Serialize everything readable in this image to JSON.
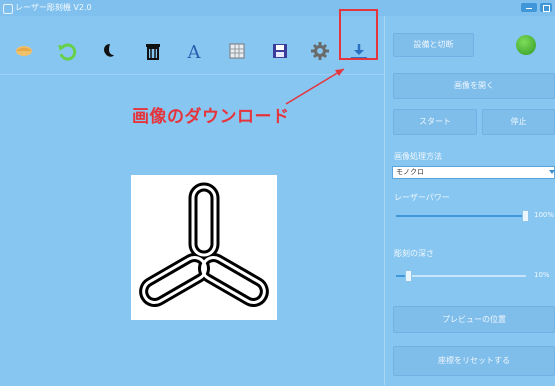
{
  "window": {
    "title": "レーザー彫刻機 V2.0"
  },
  "toolbar": {
    "items": [
      {
        "name": "eraser-icon"
      },
      {
        "name": "rotate-icon"
      },
      {
        "name": "invert-icon"
      },
      {
        "name": "trash-icon"
      },
      {
        "name": "text-icon"
      },
      {
        "name": "grid-icon"
      },
      {
        "name": "save-icon"
      },
      {
        "name": "settings-icon"
      },
      {
        "name": "download-icon"
      }
    ]
  },
  "annotation": {
    "text": "画像のダウンロード",
    "color": "#e5343c"
  },
  "right_panel": {
    "connect_button": "設備と切断",
    "open_image_button": "画像を開く",
    "start_button": "スタート",
    "stop_button": "停止",
    "processing_label": "画像処理方法",
    "processing_value": "モノクロ",
    "laser_power_label": "レーザーパワー",
    "laser_power_value": "100%",
    "laser_power_level": 1.0,
    "depth_label": "彫刻の深さ",
    "depth_value": "10%",
    "depth_level": 0.1,
    "preview_position_button": "プレビューの位置",
    "reset_coords_button": "座標をリセットする"
  },
  "colors": {
    "background": "#87c6f1",
    "accent": "#3f96d8",
    "connected": "#3aa52b"
  }
}
